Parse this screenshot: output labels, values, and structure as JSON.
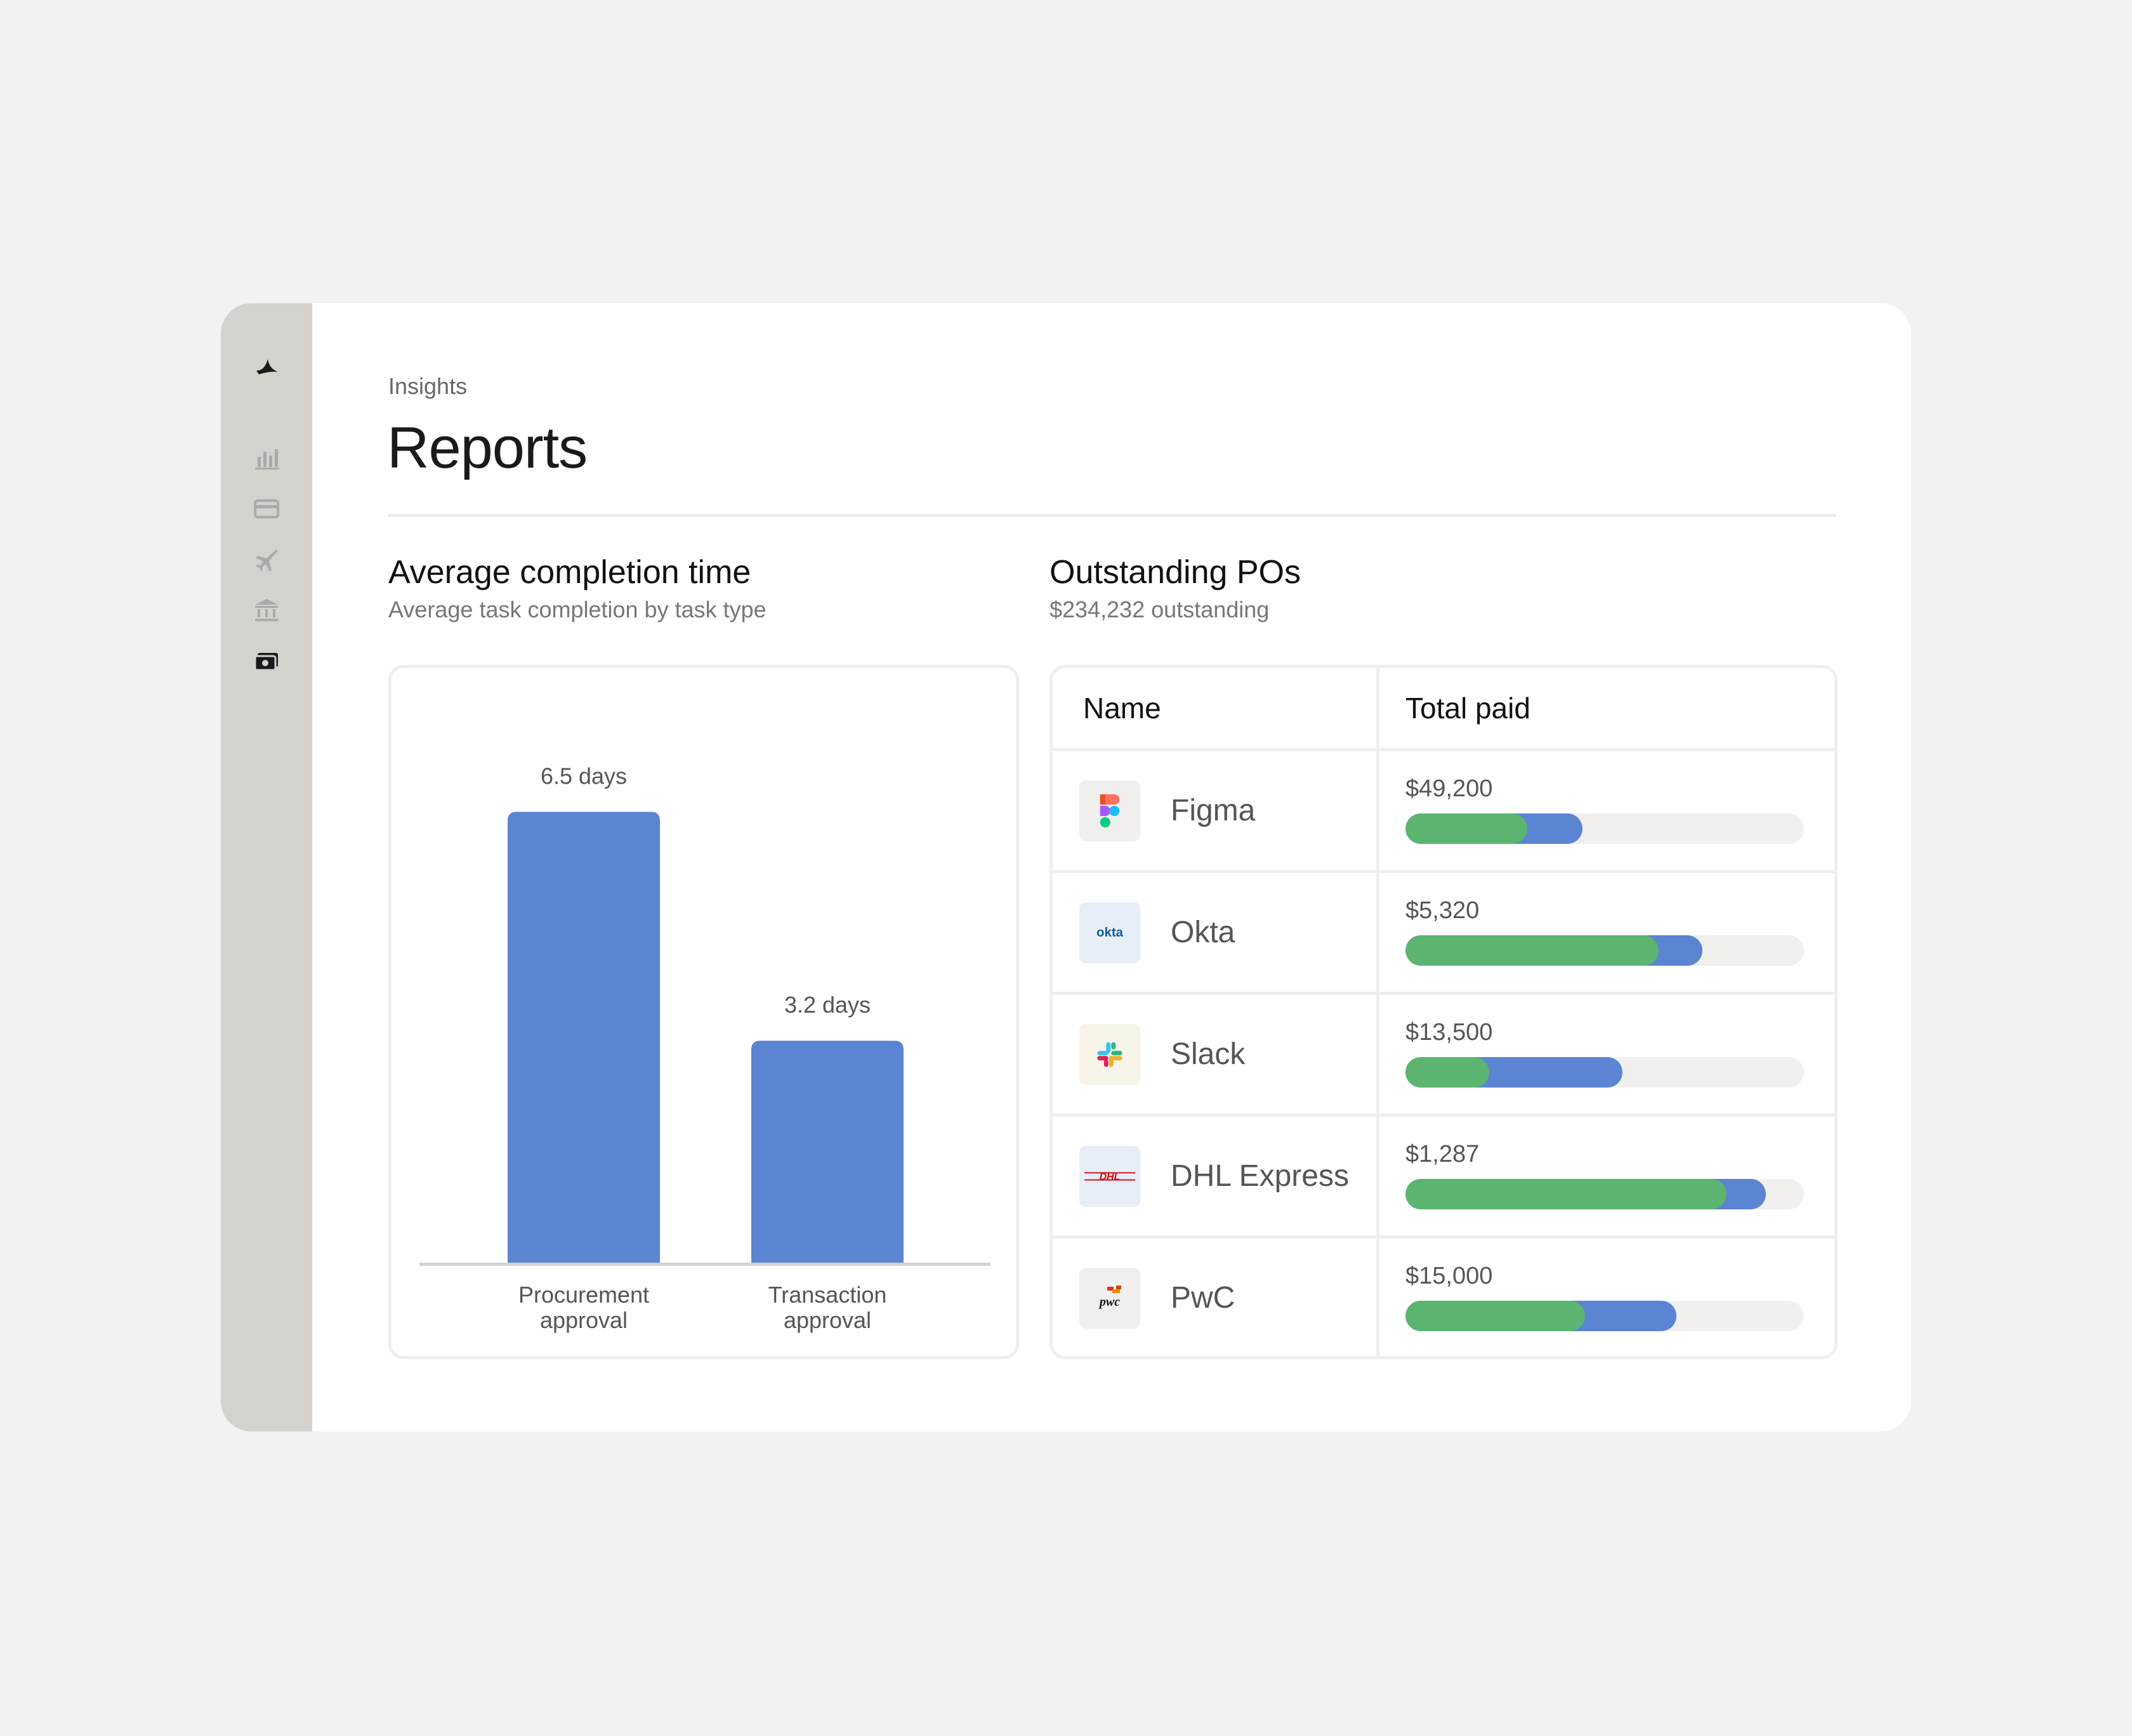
{
  "header": {
    "breadcrumb": "Insights",
    "title": "Reports"
  },
  "sidebar": {
    "items": [
      {
        "icon": "bird-logo-icon"
      },
      {
        "icon": "bar-chart-icon"
      },
      {
        "icon": "credit-card-icon"
      },
      {
        "icon": "airplane-icon"
      },
      {
        "icon": "bank-icon"
      },
      {
        "icon": "cash-icon",
        "active": true
      }
    ]
  },
  "completion": {
    "title": "Average completion time",
    "subtitle": "Average task completion by task type"
  },
  "chart_data": {
    "type": "bar",
    "categories": [
      [
        "Procurement",
        "approval"
      ],
      [
        "Transaction",
        "approval"
      ]
    ],
    "values": [
      6.5,
      3.2
    ],
    "data_labels": [
      "6.5 days",
      "3.2 days"
    ],
    "unit": "days",
    "ylim": [
      0,
      7.2
    ],
    "bar_color": "#5b84d3"
  },
  "pos": {
    "title": "Outstanding POs",
    "subtitle": "$234,232 outstanding",
    "columns": [
      "Name",
      "Total paid"
    ],
    "rows": [
      {
        "name": "Figma",
        "amount": "$49,200",
        "logo": "figma-logo",
        "blue": 0.445,
        "green": 0.305
      },
      {
        "name": "Okta",
        "amount": "$5,320",
        "logo": "okta-logo",
        "blue": 0.745,
        "green": 0.635
      },
      {
        "name": "Slack",
        "amount": "$13,500",
        "logo": "slack-logo",
        "blue": 0.545,
        "green": 0.21
      },
      {
        "name": "DHL Express",
        "amount": "$1,287",
        "logo": "dhl-logo",
        "blue": 0.905,
        "green": 0.805
      },
      {
        "name": "PwC",
        "amount": "$15,000",
        "logo": "pwc-logo",
        "blue": 0.68,
        "green": 0.45
      }
    ],
    "colors": {
      "paid": "#5bb570",
      "total": "#5b84d3"
    }
  }
}
